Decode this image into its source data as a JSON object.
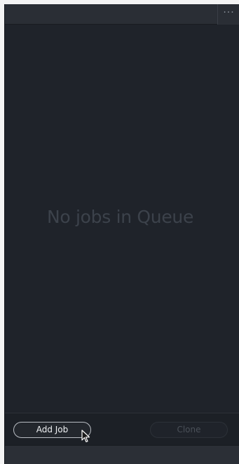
{
  "header": {
    "menu_icon": "more-horizontal-icon",
    "menu_glyph": "···"
  },
  "queue": {
    "empty_message": "No jobs in Queue"
  },
  "footer": {
    "add_job_label": "Add Job",
    "clone_label": "Clone"
  },
  "colors": {
    "panel_bg": "#1f232a",
    "header_bg": "#2a2e35",
    "empty_text": "#3c424b",
    "button_border": "#b8bcc2"
  }
}
